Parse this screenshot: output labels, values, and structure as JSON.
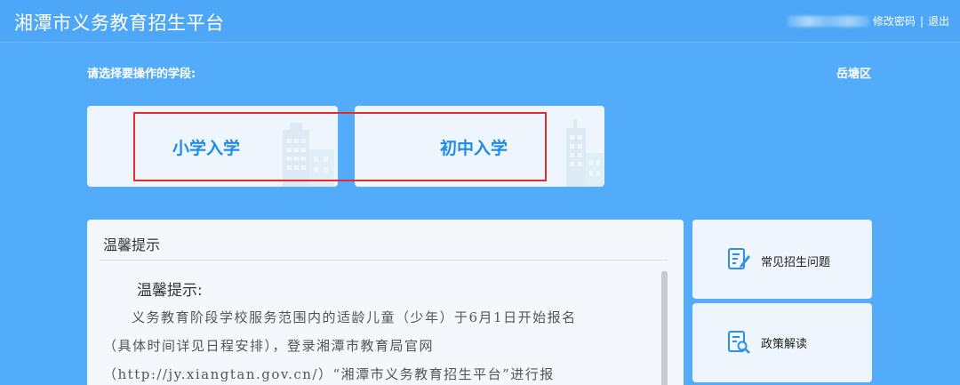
{
  "header": {
    "title": "湘潭市义务教育招生平台",
    "change_password": "修改密码",
    "separator": "|",
    "logout": "退出"
  },
  "selection": {
    "prompt": "请选择要操作的学段:",
    "district": "岳塘区",
    "options": [
      {
        "label": "小学入学",
        "icon": "building-icon"
      },
      {
        "label": "初中入学",
        "icon": "building-icon"
      }
    ]
  },
  "notice": {
    "title": "温馨提示",
    "heading": "温馨提示:",
    "lines": [
      "义务教育阶段学校服务范围内的适龄儿童（少年）于6月1日开始报名",
      "（具体时间详见日程安排），登录湘潭市教育局官网",
      "（http://jy.xiangtan.gov.cn/）“湘潭市义务教育招生平台”进行报"
    ]
  },
  "side_links": [
    {
      "label": "常见招生问题",
      "icon": "edit-document-icon"
    },
    {
      "label": "政策解读",
      "icon": "document-search-icon"
    }
  ],
  "colors": {
    "background": "#53acf9",
    "card": "#eef5fc",
    "accent": "#1f8be8",
    "highlight": "#e42a2a"
  }
}
